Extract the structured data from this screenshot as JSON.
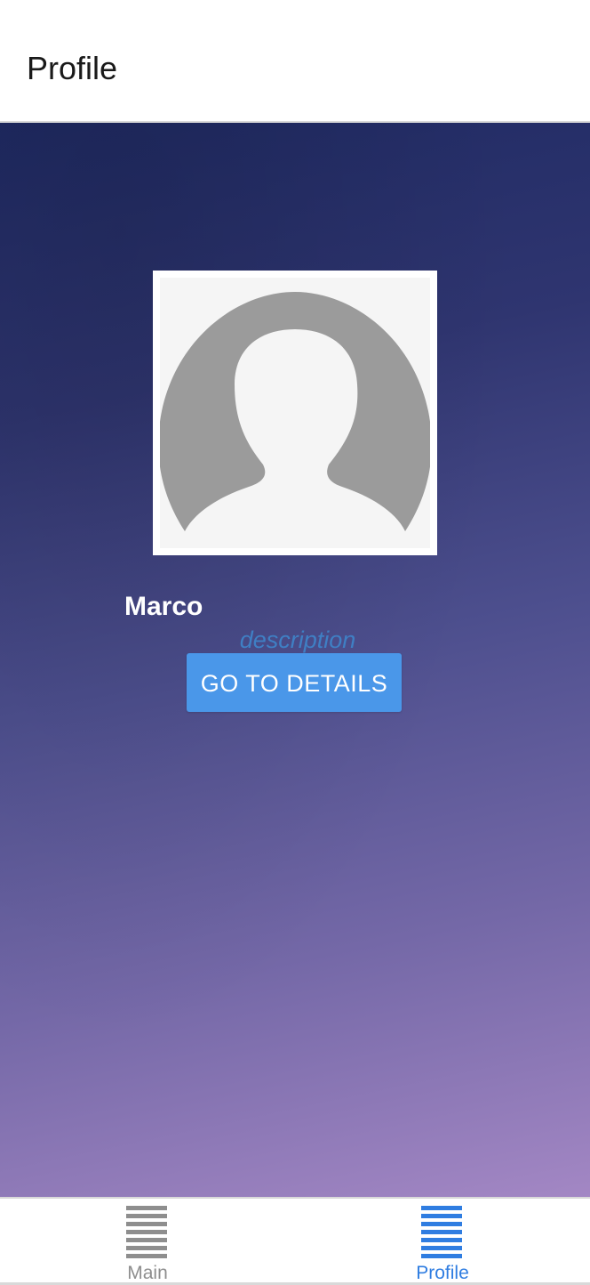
{
  "header": {
    "title": "Profile"
  },
  "profile": {
    "name": "Marco",
    "description": "description",
    "avatar_icon": "default-user-silhouette-icon",
    "details_button_label": "GO TO DETAILS"
  },
  "tabs": [
    {
      "label": "Main",
      "icon": "menu-lines-icon",
      "active": false
    },
    {
      "label": "Profile",
      "icon": "menu-lines-icon",
      "active": true
    }
  ],
  "colors": {
    "accent": "#2f7de1",
    "button": "#4a97e9",
    "description": "#3f7fc4",
    "inactive_tab": "#8e8e8e",
    "gradient_top": "#1f2a63",
    "gradient_bottom": "#a387c4"
  }
}
